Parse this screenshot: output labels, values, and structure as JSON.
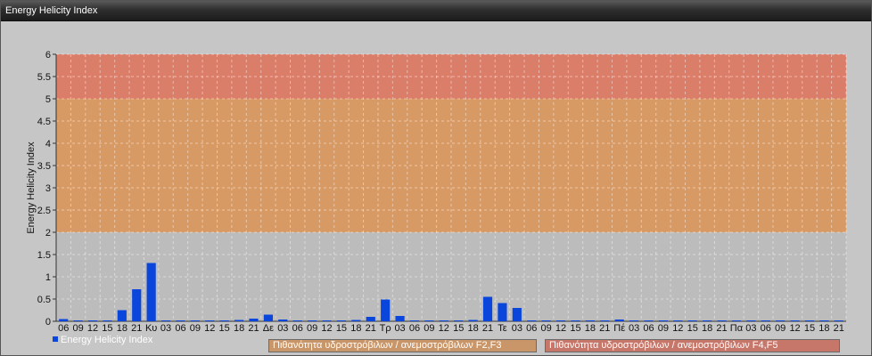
{
  "window": {
    "title": "Energy Helicity Index"
  },
  "legend": {
    "series_label": "Energy Helicity Index",
    "series_color": "#0a46dc",
    "band_f2f3_label": "Πιθανότητα υδροστρόβιλων / ανεμοστρόβιλων F2,F3",
    "band_f2f3_color": "#c9966a",
    "band_f4f5_label": "Πιθανότητα υδροστρόβιλων / ανεμοστρόβιλων F4,F5",
    "band_f4f5_color": "#c7776a"
  },
  "chart_data": {
    "type": "bar",
    "ylabel": "Energy Helicity Index",
    "ylim": [
      0,
      6
    ],
    "ytick_labels": [
      "0",
      "0.5",
      "1",
      "1.5",
      "2",
      "2.5",
      "3",
      "3.5",
      "4",
      "4.5",
      "5",
      "5.5",
      "6"
    ],
    "grid": true,
    "bands": [
      {
        "from": 0,
        "to": 2,
        "color": "#bcbcbc"
      },
      {
        "from": 2,
        "to": 5,
        "color": "#d79a65"
      },
      {
        "from": 5,
        "to": 6,
        "color": "#da7e6a"
      }
    ],
    "categories": [
      "06",
      "09",
      "12",
      "15",
      "18",
      "21",
      "Κυ",
      "03",
      "06",
      "09",
      "12",
      "15",
      "18",
      "21",
      "Δε",
      "03",
      "06",
      "09",
      "12",
      "15",
      "18",
      "21",
      "Τρ",
      "03",
      "06",
      "09",
      "12",
      "15",
      "18",
      "21",
      "Τε",
      "03",
      "06",
      "09",
      "12",
      "15",
      "18",
      "21",
      "Πέ",
      "03",
      "06",
      "09",
      "12",
      "15",
      "18",
      "21",
      "Πα",
      "03",
      "06",
      "09",
      "12",
      "15",
      "18",
      "21"
    ],
    "series": [
      {
        "name": "Energy Helicity Index",
        "color": "#0a46dc",
        "values": [
          0.05,
          0.02,
          0.02,
          0.02,
          0.25,
          0.72,
          1.31,
          0.02,
          0.02,
          0.02,
          0.02,
          0.02,
          0.03,
          0.06,
          0.15,
          0.04,
          0.02,
          0.02,
          0.02,
          0.02,
          0.03,
          0.1,
          0.49,
          0.12,
          0.02,
          0.02,
          0.02,
          0.02,
          0.03,
          0.55,
          0.41,
          0.3,
          0.02,
          0.02,
          0.02,
          0.02,
          0.02,
          0.02,
          0.04,
          0.02,
          0.02,
          0.02,
          0.02,
          0.02,
          0.02,
          0.02,
          0.02,
          0.02,
          0.02,
          0.02,
          0.02,
          0.02,
          0.02,
          0.02
        ]
      }
    ]
  }
}
